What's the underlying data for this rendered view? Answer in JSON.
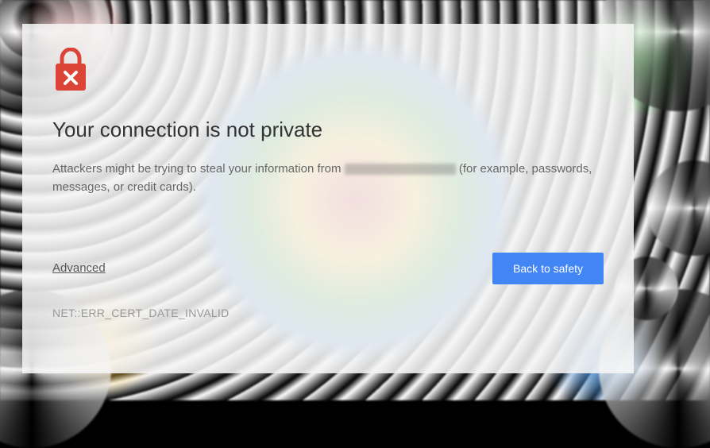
{
  "dialog": {
    "title": "Your connection is not private",
    "message_prefix": "Attackers might be trying to steal your information from ",
    "message_suffix": " (for example, passwords, messages, or credit cards).",
    "advanced_label": "Advanced",
    "safety_button_label": "Back to safety",
    "error_code": "NET::ERR_CERT_DATE_INVALID"
  },
  "colors": {
    "lock_red": "#db4437",
    "button_blue": "#4285f4"
  }
}
